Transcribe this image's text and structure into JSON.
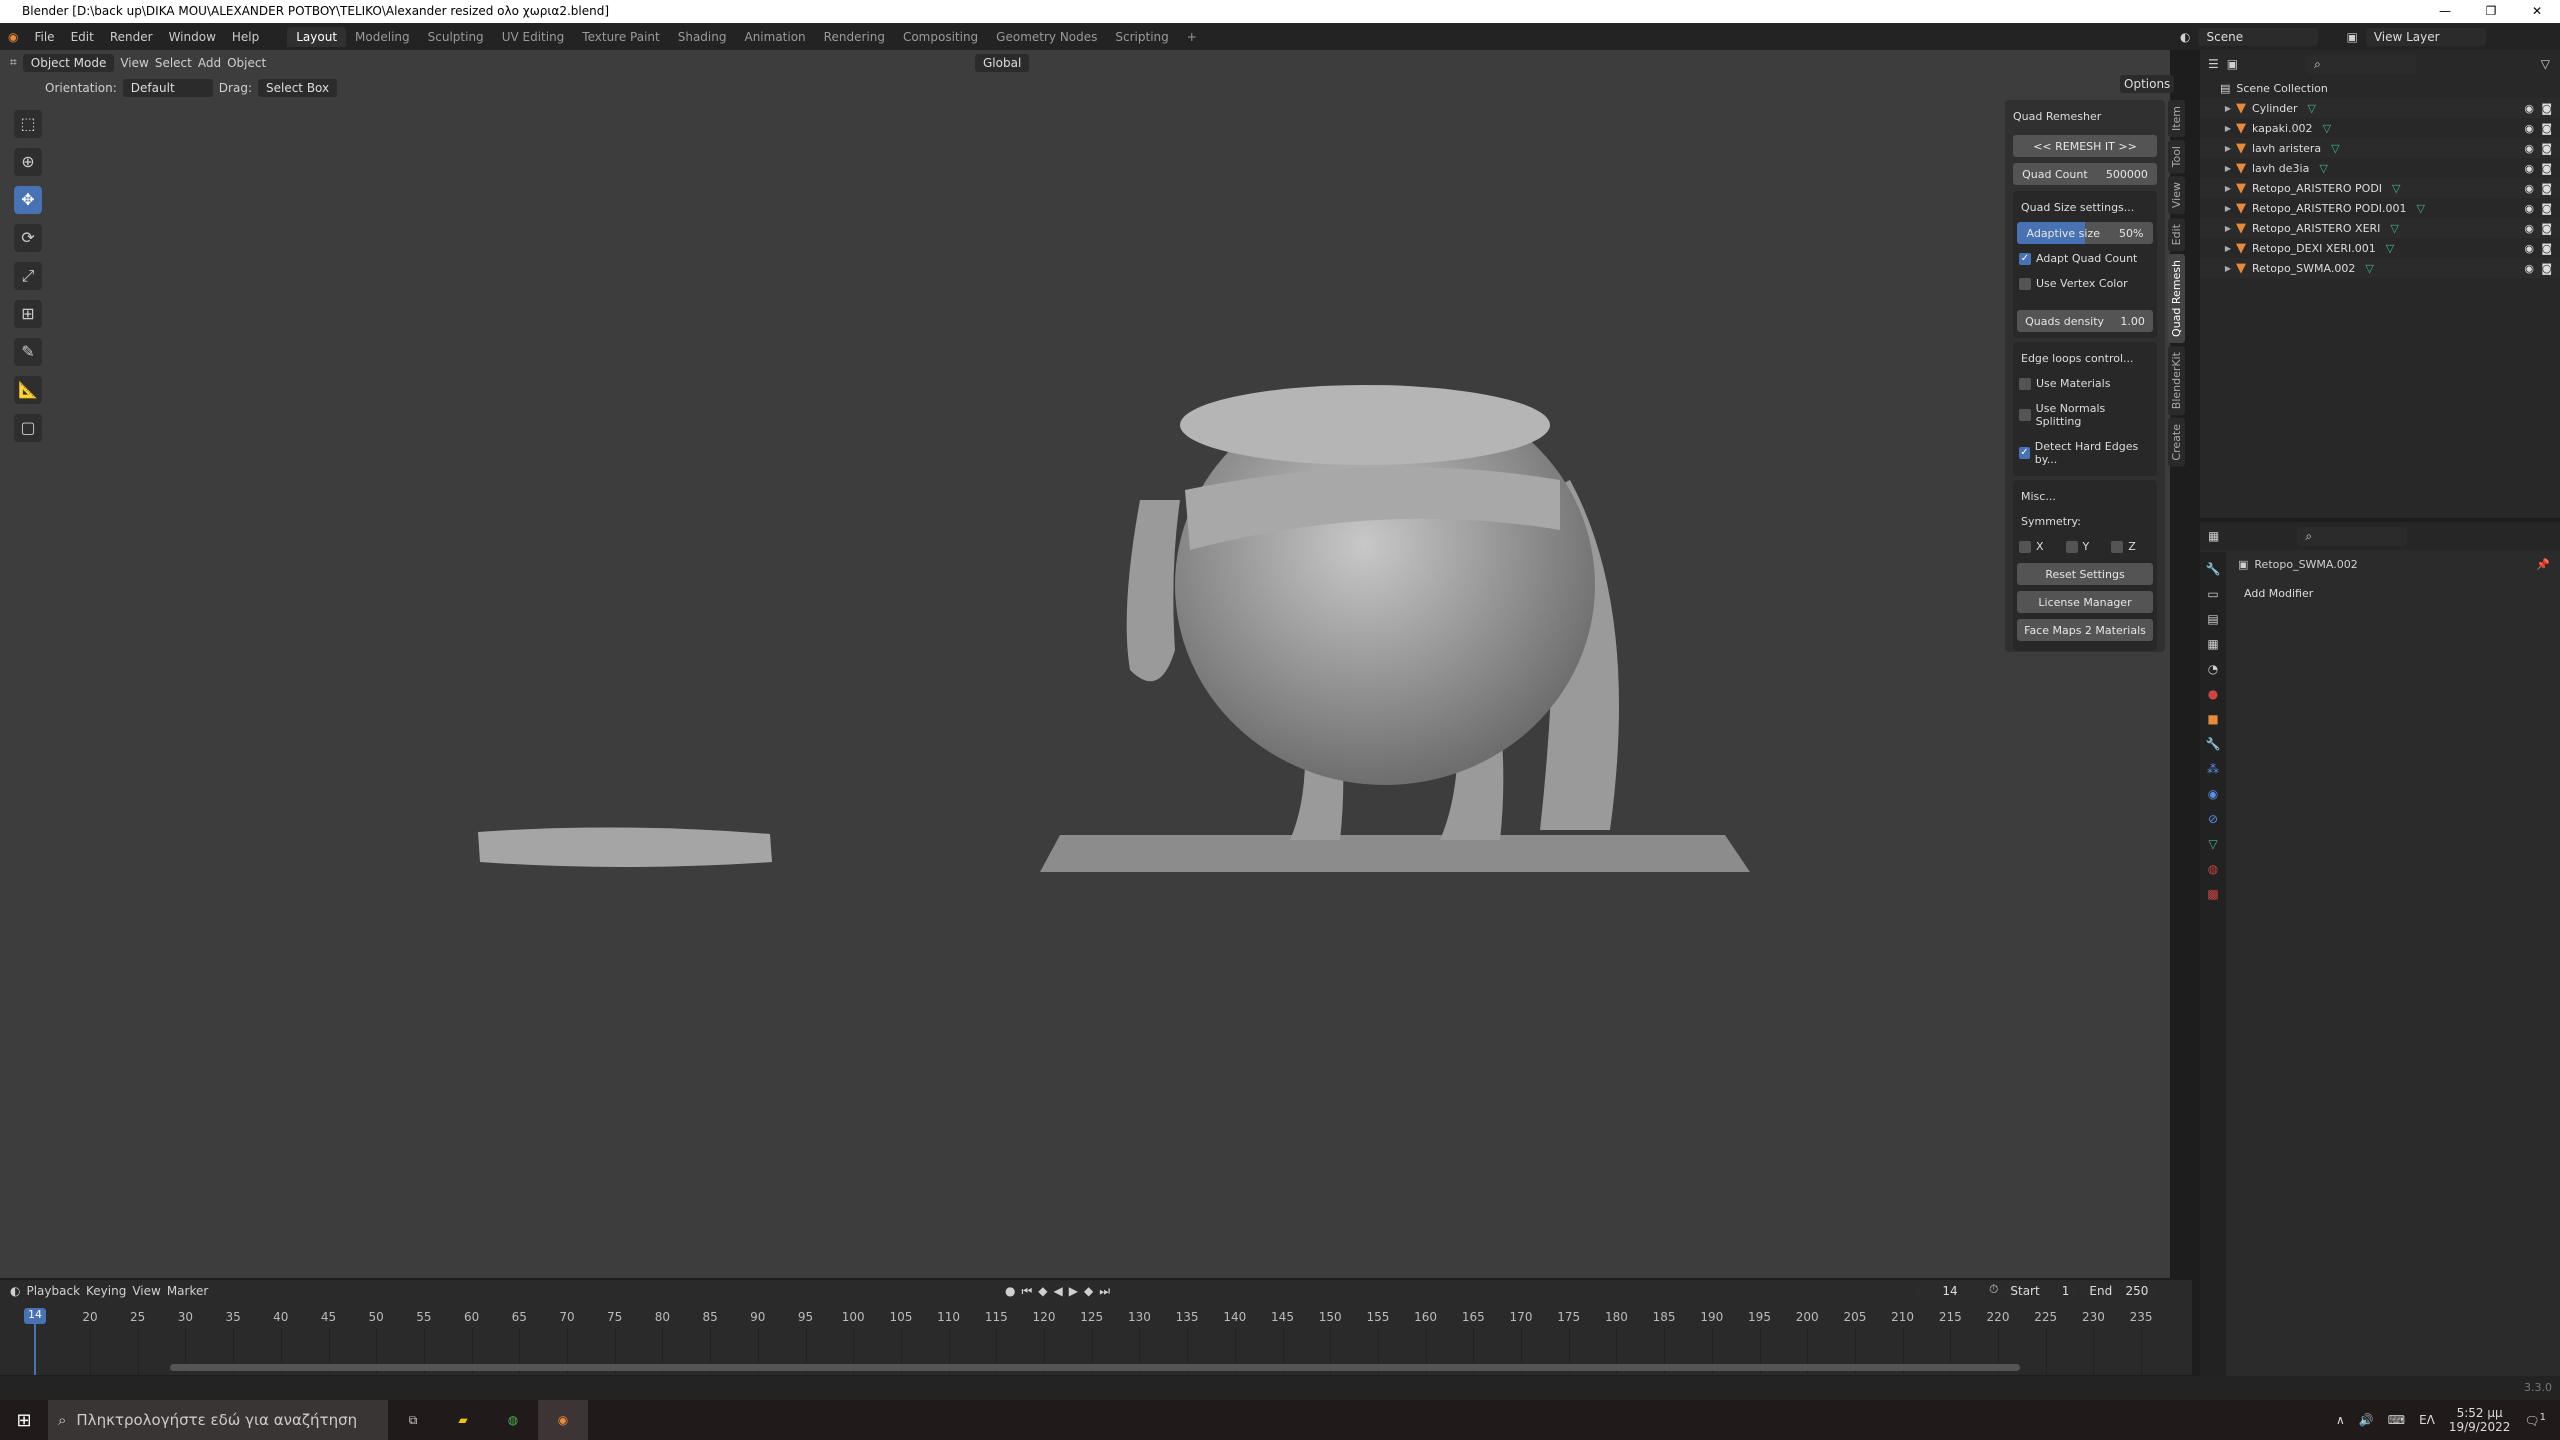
{
  "window": {
    "title": "Blender [D:\\back up\\DIKA MOU\\ALEXANDER POTBOY\\TELIKO\\Alexander resized  ολο χωρια2.blend]",
    "controls": [
      "—",
      "❐",
      "✕"
    ]
  },
  "menu": [
    "File",
    "Edit",
    "Render",
    "Window",
    "Help"
  ],
  "workspaces": [
    "Layout",
    "Modeling",
    "Sculpting",
    "UV Editing",
    "Texture Paint",
    "Shading",
    "Animation",
    "Rendering",
    "Compositing",
    "Geometry Nodes",
    "Scripting",
    "+"
  ],
  "active_workspace": "Layout",
  "scene": {
    "label": "Scene",
    "view_layer": "View Layer"
  },
  "viewport_header": {
    "mode": "Object Mode",
    "menus": [
      "View",
      "Select",
      "Add",
      "Object"
    ],
    "transform": "Global",
    "options": "Options"
  },
  "tool_settings": {
    "orientation_label": "Orientation:",
    "orientation": "Default",
    "drag_label": "Drag:",
    "drag": "Select Box"
  },
  "npanel": {
    "title": "Quad Remesher",
    "remesh": "<<  REMESH IT  >>",
    "quad_count_label": "Quad Count",
    "quad_count": "500000",
    "quad_size": "Quad Size settings...",
    "adaptive_label": "Adaptive size",
    "adaptive_value": "50%",
    "adaptive_fraction": 0.5,
    "adapt_quad_count": "Adapt Quad Count",
    "use_vertex_color": "Use Vertex Color",
    "density_label": "Quads density",
    "density": "1.00",
    "edge_loops": "Edge loops control...",
    "use_materials": "Use Materials",
    "use_normals": "Use Normals Splitting",
    "detect_hard": "Detect Hard Edges by...",
    "misc": "Misc...",
    "symmetry": "Symmetry:",
    "x": "X",
    "y": "Y",
    "z": "Z",
    "reset": "Reset Settings",
    "license": "License Manager",
    "facemaps": "Face Maps 2 Materials"
  },
  "sidebar_tabs": [
    "Item",
    "Tool",
    "View",
    "Edit",
    "Quad Remesh",
    "BlenderKit",
    "Create"
  ],
  "outliner": {
    "root": "Scene Collection",
    "items": [
      "Cylinder",
      "kapaki.002",
      "lavh aristera",
      "lavh de3ia",
      "Retopo_ARISTERO PODI",
      "Retopo_ARISTERO PODI.001",
      "Retopo_ARISTERO XERI",
      "Retopo_DEXI XERI.001",
      "Retopo_SWMA.002"
    ]
  },
  "properties": {
    "object": "Retopo_SWMA.002",
    "add_modifier": "Add Modifier"
  },
  "timeline": {
    "menus": [
      "Playback",
      "Keying",
      "View",
      "Marker"
    ],
    "current_frame": "14",
    "start_label": "Start",
    "start": "1",
    "end_label": "End",
    "end": "250",
    "ticks": [
      "20",
      "25",
      "30",
      "35",
      "40",
      "45",
      "50",
      "55",
      "60",
      "65",
      "70",
      "75",
      "80",
      "85",
      "90",
      "95",
      "100",
      "105",
      "110",
      "115",
      "120",
      "125",
      "130",
      "135",
      "140",
      "145",
      "150",
      "155",
      "160",
      "165",
      "170",
      "175",
      "180",
      "185",
      "190",
      "195",
      "200",
      "205",
      "210",
      "215",
      "220",
      "225",
      "230",
      "235"
    ]
  },
  "status": {
    "version": "3.3.0"
  },
  "taskbar": {
    "search": "Πληκτρολογήστε εδώ για αναζήτηση",
    "lang": "ΕΛ",
    "time": "5:52 μμ",
    "date": "19/9/2022",
    "notifications": "1"
  }
}
